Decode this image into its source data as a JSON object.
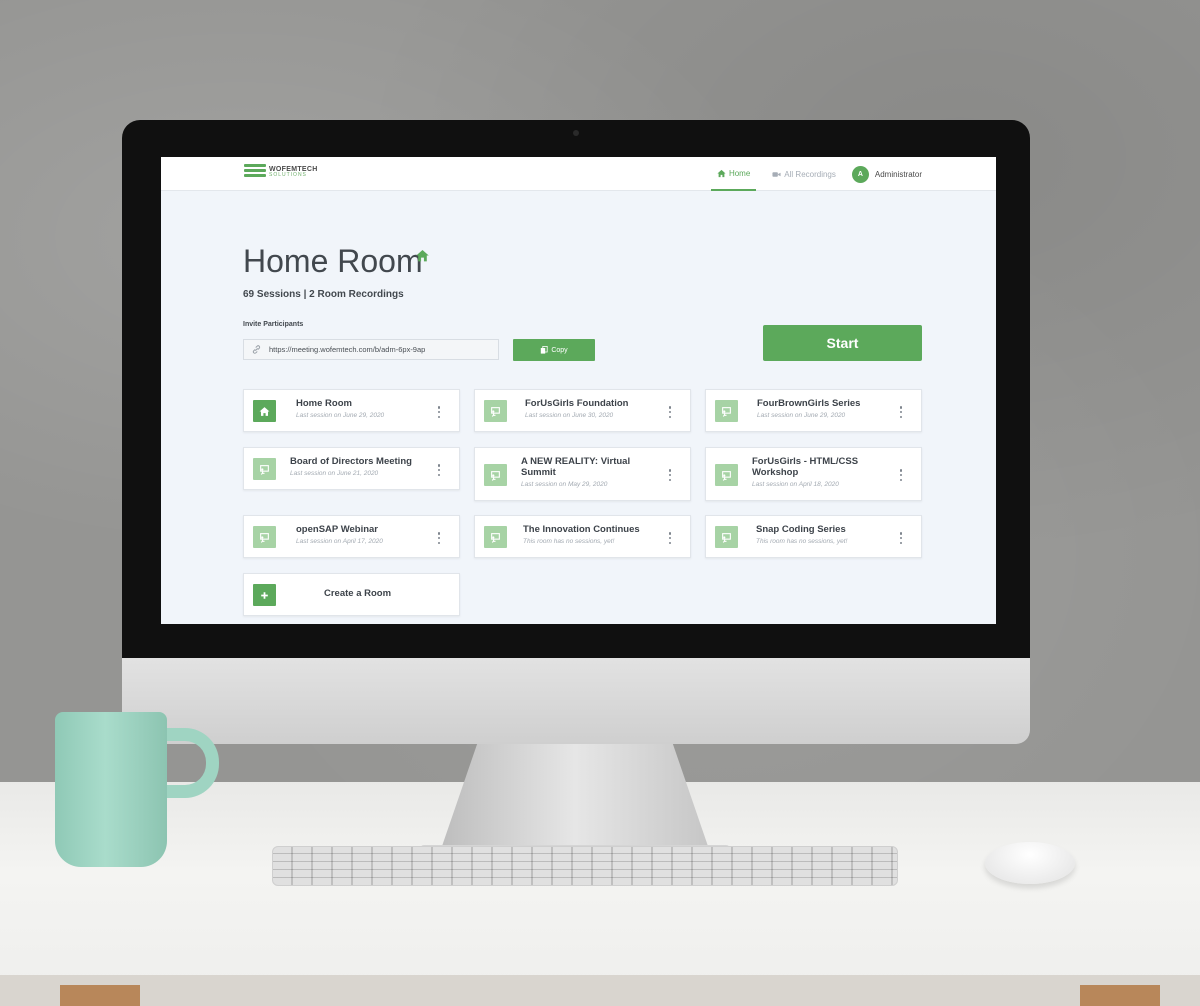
{
  "app": {
    "logo_name": "WOFEMTECH",
    "logo_sub": "SOLUTIONS",
    "accent_color": "#5ca95b"
  },
  "nav": {
    "home_label": "Home",
    "recordings_label": "All Recordings",
    "user_initial": "A",
    "user_name": "Administrator"
  },
  "room": {
    "title": "Home Room",
    "stats": "69 Sessions | 2 Room Recordings",
    "invite_label": "Invite Participants",
    "invite_url": "https://meeting.wofemtech.com/b/adm-6px-9ap",
    "copy_label": "Copy",
    "start_label": "Start"
  },
  "rooms": [
    {
      "name": "Home Room",
      "sub": "Last session on June 29, 2020",
      "icon": "home-icon"
    },
    {
      "name": "ForUsGirls Foundation",
      "sub": "Last session on June 30, 2020",
      "icon": "chalkboard-icon"
    },
    {
      "name": "FourBrownGirls Series",
      "sub": "Last session on June 29, 2020",
      "icon": "chalkboard-icon"
    },
    {
      "name": "Board of Directors Meeting",
      "sub": "Last session on June 21, 2020",
      "icon": "chalkboard-icon"
    },
    {
      "name": "A NEW REALITY: Virtual Summit",
      "sub": "Last session on May 29, 2020",
      "icon": "chalkboard-icon"
    },
    {
      "name": "ForUsGirls - HTML/CSS Workshop",
      "sub": "Last session on April 18, 2020",
      "icon": "chalkboard-icon"
    },
    {
      "name": "openSAP Webinar",
      "sub": "Last session on April 17, 2020",
      "icon": "chalkboard-icon"
    },
    {
      "name": "The Innovation Continues",
      "sub": "This room has no sessions, yet!",
      "icon": "chalkboard-icon"
    },
    {
      "name": "Snap Coding Series",
      "sub": "This room has no sessions, yet!",
      "icon": "chalkboard-icon"
    }
  ],
  "create_room_label": "Create a Room"
}
